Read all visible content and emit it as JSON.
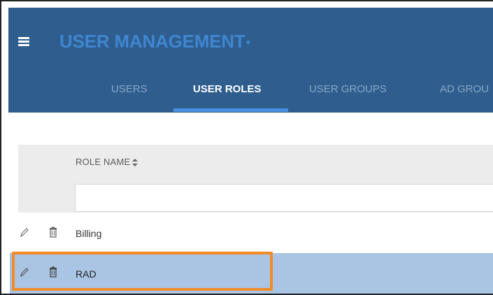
{
  "header": {
    "title": "USER MANAGEMENT",
    "title_caret": "▾",
    "menu_icon": "hamburger-icon"
  },
  "tabs": [
    {
      "label": "USERS",
      "active": false
    },
    {
      "label": "USER ROLES",
      "active": true
    },
    {
      "label": "USER GROUPS",
      "active": false
    },
    {
      "label": "AD GROU",
      "active": false
    }
  ],
  "grid": {
    "column_header": "ROLE NAME",
    "sort_icon": "sort-icon",
    "filter_value": "",
    "filter_placeholder": "",
    "rows": [
      {
        "name": "Billing",
        "selected": false
      },
      {
        "name": "RAD",
        "selected": true
      }
    ]
  },
  "colors": {
    "header_bg": "#2e5d8e",
    "title": "#3f86d0",
    "tab_inactive": "#8aa7c4",
    "tab_active": "#ffffff",
    "tab_indicator": "#4a90e2",
    "selected_row": "#a9c5e3",
    "highlight": "#f28c28"
  }
}
